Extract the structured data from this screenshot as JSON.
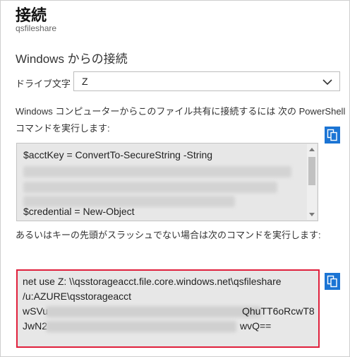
{
  "header": {
    "title": "接続",
    "subtitle": "qsfileshare"
  },
  "section": {
    "heading": "Windows からの接続"
  },
  "drive": {
    "label": "ドライブ文字",
    "value": "Z"
  },
  "powershell": {
    "description": "Windows コンピューターからこのファイル共有に接続するには 次の PowerShell コマンドを実行します:",
    "line1": "$acctKey = ConvertTo-SecureString -String",
    "line_last": "$credential = New-Object"
  },
  "alternative": {
    "description": "あるいはキーの先頭がスラッシュでない場合は次のコマンドを実行します:"
  },
  "net_use": {
    "line1": "net use Z: \\\\qsstorageacct.file.core.windows.net\\qsfileshare",
    "line2": "/u:AZURE\\qsstorageacct",
    "line3_start": "wSVu",
    "line3_end": "QhuTT6oRcwT8",
    "line4_start": "JwN2",
    "line4_end": "wvQ=="
  },
  "icons": {
    "copy": "copy-icon",
    "dropdown": "chevron-down-icon"
  },
  "colors": {
    "accent": "#1b74d4",
    "highlight_border": "#e0203c",
    "code_bg": "#e7e7e7"
  }
}
